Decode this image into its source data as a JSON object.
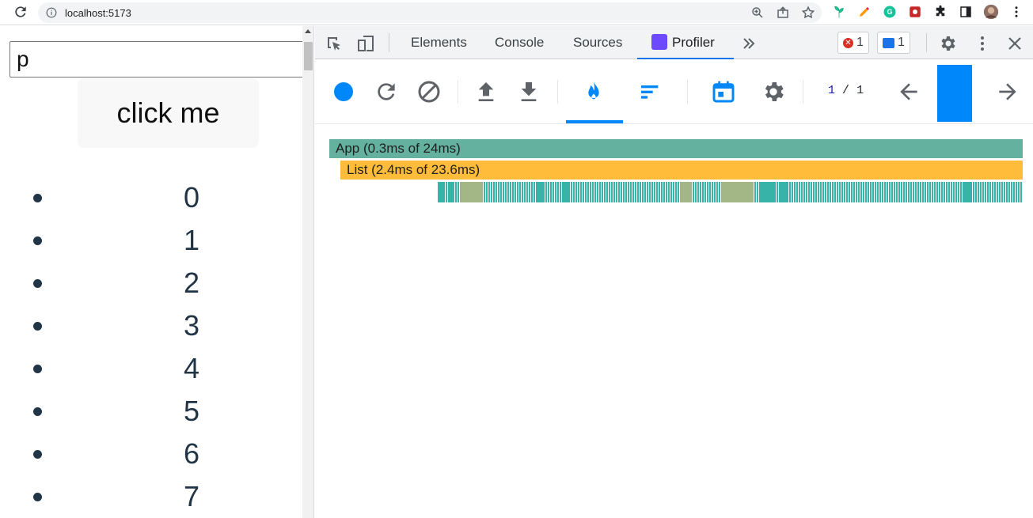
{
  "browser": {
    "url": "localhost:5173"
  },
  "page": {
    "input_value": "p",
    "button_label": "click me",
    "list_items": [
      "0",
      "1",
      "2",
      "3",
      "4",
      "5",
      "6",
      "7"
    ]
  },
  "devtools": {
    "tabs": {
      "elements": "Elements",
      "console": "Console",
      "sources": "Sources",
      "profiler": "Profiler"
    },
    "error_count": "1",
    "message_count": "1"
  },
  "profiler": {
    "commit_current": "1",
    "commit_separator": "/",
    "commit_total": "1",
    "flame": {
      "app_label": "App (0.3ms of 24ms)",
      "list_label": "List (2.4ms of 23.6ms)"
    }
  },
  "colors": {
    "app_bar": "#63b19e",
    "list_bar": "#ffbc3a",
    "item_bar": "#37b3a7",
    "item_bar_slow": "#a2b686",
    "accent": "#0088fa"
  },
  "icons": {
    "record": "record-icon",
    "reload": "reload-icon",
    "clear": "clear-icon",
    "upload": "upload-icon",
    "download": "download-icon",
    "flamegraph": "flame-icon",
    "ranked": "ranked-chart-icon",
    "timeline": "calendar-icon",
    "settings": "gear-icon",
    "prev": "arrow-left-icon",
    "next": "arrow-right-icon"
  }
}
